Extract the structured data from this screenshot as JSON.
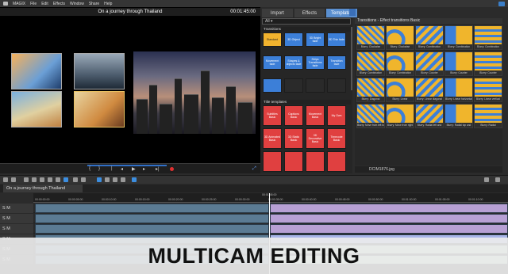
{
  "menubar": {
    "app_name": "MAGIX",
    "items": [
      "File",
      "Edit",
      "Effects",
      "Window",
      "Share",
      "Help"
    ]
  },
  "preview": {
    "title": "On a journey through Thailand",
    "timecode": "00:01:45:00"
  },
  "tabs": [
    "Import",
    "Effects",
    "Templates"
  ],
  "category_select": "All",
  "library": {
    "transitions_header": "Transitions",
    "transition_tiles": [
      "Standard",
      "3D Object",
      "3D Bright fade",
      "3D Thin fade",
      "Movement fade",
      "Shapes & objects fade",
      "Strips Transitions fade",
      "Transition fade"
    ],
    "title_header": "Title templates",
    "title_tiles": [
      "Subtitles Basic",
      "Captions Basic",
      "Movement Basic",
      "My Own",
      "3D Animated Basic",
      "3D Static Basic",
      "3D Decorative Basic",
      "Timecode Basic"
    ]
  },
  "transitions_panel": {
    "header": "Transitions - Effect transitions Basic",
    "footer_file": "DCIM1876.jpg",
    "items": [
      "Blurry: Clockwise",
      "Blurry: Clockwise around center point",
      "Blurry: Combination radial to fade",
      "Blurry: Combination from top to bottom",
      "Blurry: Combination radial to linear",
      "Blurry: Combination radial to linear",
      "Blurry: Combination radial to linear",
      "Blurry: Counter clockwise",
      "Blurry: Counter clockwise around center",
      "Blurry: Counter clockwise",
      "Blurry: Diagonal",
      "Blurry: Linear",
      "Blurry: Linear diagonal right",
      "Blurry: Linear horizontal",
      "Blurry: Linear vertical",
      "Blurry: Move from left to right",
      "Blurry: Move from right to left",
      "Blurry: Radial left and right",
      "Blurry: Radial top and bottom",
      "Blurry: Radial"
    ]
  },
  "timeline": {
    "tab": "On a journey through Thailand",
    "center_timecode": "00:01:45:00",
    "ruler_ticks": [
      "00:00:00:00",
      "00:00:05:00",
      "00:00:10:00",
      "00:00:15:00",
      "00:00:20:00",
      "00:00:25:00",
      "00:00:30:00",
      "00:00:35:00",
      "00:00:40:00",
      "00:00:45:00",
      "00:00:50:00",
      "00:01:00:00",
      "00:01:05:00",
      "00:01:10:00"
    ],
    "track_labels": [
      "S M",
      "S M",
      "S M",
      "S M",
      "S M",
      "S M"
    ]
  },
  "banner": {
    "text": "MULTICAM EDITING"
  },
  "colors": {
    "accent_blue": "#3c7fd8",
    "tile_yellow": "#f2b32e",
    "tile_red": "#e04040",
    "record_red": "#e03030"
  }
}
